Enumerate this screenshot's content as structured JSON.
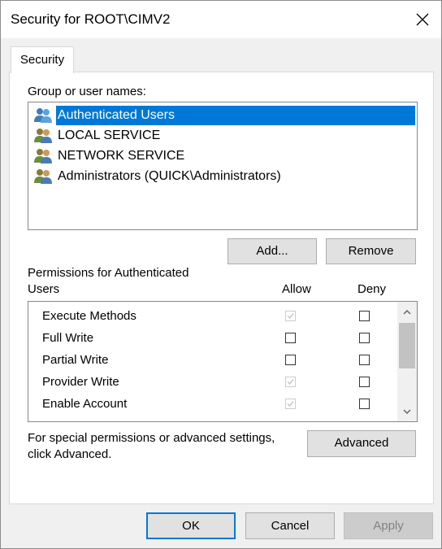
{
  "window": {
    "title": "Security for ROOT\\CIMV2"
  },
  "tabs": [
    {
      "label": "Security"
    }
  ],
  "group_section": {
    "label": "Group or user names:",
    "items": [
      {
        "label": "Authenticated Users",
        "icon": "users-group-icon",
        "selected": true
      },
      {
        "label": "LOCAL SERVICE",
        "icon": "users-group-icon",
        "selected": false
      },
      {
        "label": "NETWORK SERVICE",
        "icon": "users-group-icon",
        "selected": false
      },
      {
        "label": "Administrators (QUICK\\Administrators)",
        "icon": "users-group-icon",
        "selected": false
      }
    ],
    "add_label": "Add...",
    "remove_label": "Remove"
  },
  "permissions": {
    "label_line1": "Permissions for Authenticated",
    "label_line2": "Users",
    "allow_header": "Allow",
    "deny_header": "Deny",
    "rows": [
      {
        "name": "Execute Methods",
        "allow": "checked-disabled",
        "deny": "unchecked"
      },
      {
        "name": "Full Write",
        "allow": "unchecked",
        "deny": "unchecked"
      },
      {
        "name": "Partial Write",
        "allow": "unchecked",
        "deny": "unchecked"
      },
      {
        "name": "Provider Write",
        "allow": "checked-disabled",
        "deny": "unchecked"
      },
      {
        "name": "Enable Account",
        "allow": "checked-disabled",
        "deny": "unchecked"
      }
    ]
  },
  "advanced": {
    "text_line1": "For special permissions or advanced settings,",
    "text_line2": "click Advanced.",
    "button_label": "Advanced"
  },
  "footer": {
    "ok_label": "OK",
    "cancel_label": "Cancel",
    "apply_label": "Apply"
  },
  "colors": {
    "selection": "#0078d7",
    "button_face": "#e1e1e1",
    "dialog_bg": "#f0f0f0"
  }
}
